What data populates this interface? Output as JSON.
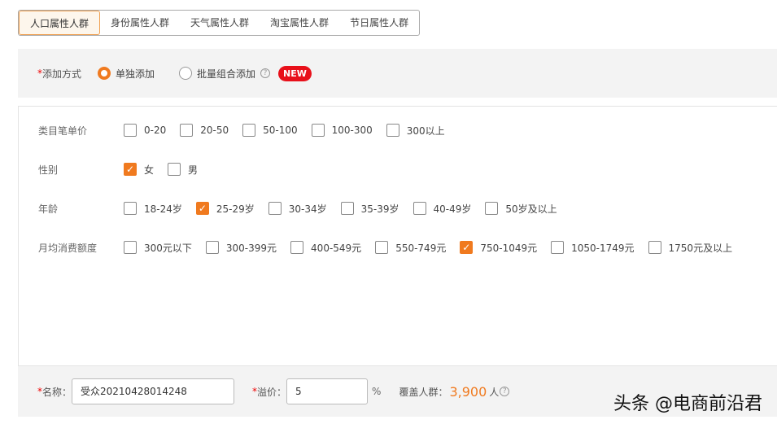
{
  "tabs": [
    "人口属性人群",
    "身份属性人群",
    "天气属性人群",
    "淘宝属性人群",
    "节日属性人群"
  ],
  "mode": {
    "label": "添加方式",
    "required": "*",
    "options": [
      "单独添加",
      "批量组合添加"
    ],
    "selected": 0,
    "help": "?",
    "badge": "NEW"
  },
  "filters": [
    {
      "label": "类目笔单价",
      "options": [
        {
          "t": "0-20",
          "c": false
        },
        {
          "t": "20-50",
          "c": false
        },
        {
          "t": "50-100",
          "c": false
        },
        {
          "t": "100-300",
          "c": false
        },
        {
          "t": "300以上",
          "c": false
        }
      ]
    },
    {
      "label": "性别",
      "options": [
        {
          "t": "女",
          "c": true
        },
        {
          "t": "男",
          "c": false
        }
      ]
    },
    {
      "label": "年龄",
      "options": [
        {
          "t": "18-24岁",
          "c": false
        },
        {
          "t": "25-29岁",
          "c": true
        },
        {
          "t": "30-34岁",
          "c": false
        },
        {
          "t": "35-39岁",
          "c": false
        },
        {
          "t": "40-49岁",
          "c": false
        },
        {
          "t": "50岁及以上",
          "c": false
        }
      ]
    },
    {
      "label": "月均消费额度",
      "options": [
        {
          "t": "300元以下",
          "c": false
        },
        {
          "t": "300-399元",
          "c": false
        },
        {
          "t": "400-549元",
          "c": false
        },
        {
          "t": "550-749元",
          "c": false
        },
        {
          "t": "750-1049元",
          "c": true
        },
        {
          "t": "1050-1749元",
          "c": false
        },
        {
          "t": "1750元及以上",
          "c": false
        }
      ]
    }
  ],
  "footer": {
    "required": "*",
    "name_label": "名称：",
    "name_value": "受众20210428014248",
    "premium_label": "溢价：",
    "premium_value": "5",
    "percent": "%",
    "coverage_label": "覆盖人群：",
    "coverage_value": "3,900",
    "coverage_unit": "人",
    "help": "?"
  },
  "watermark": "头条 @电商前沿君",
  "colors": {
    "accent": "#f07a1f",
    "badge": "#e8101a"
  }
}
